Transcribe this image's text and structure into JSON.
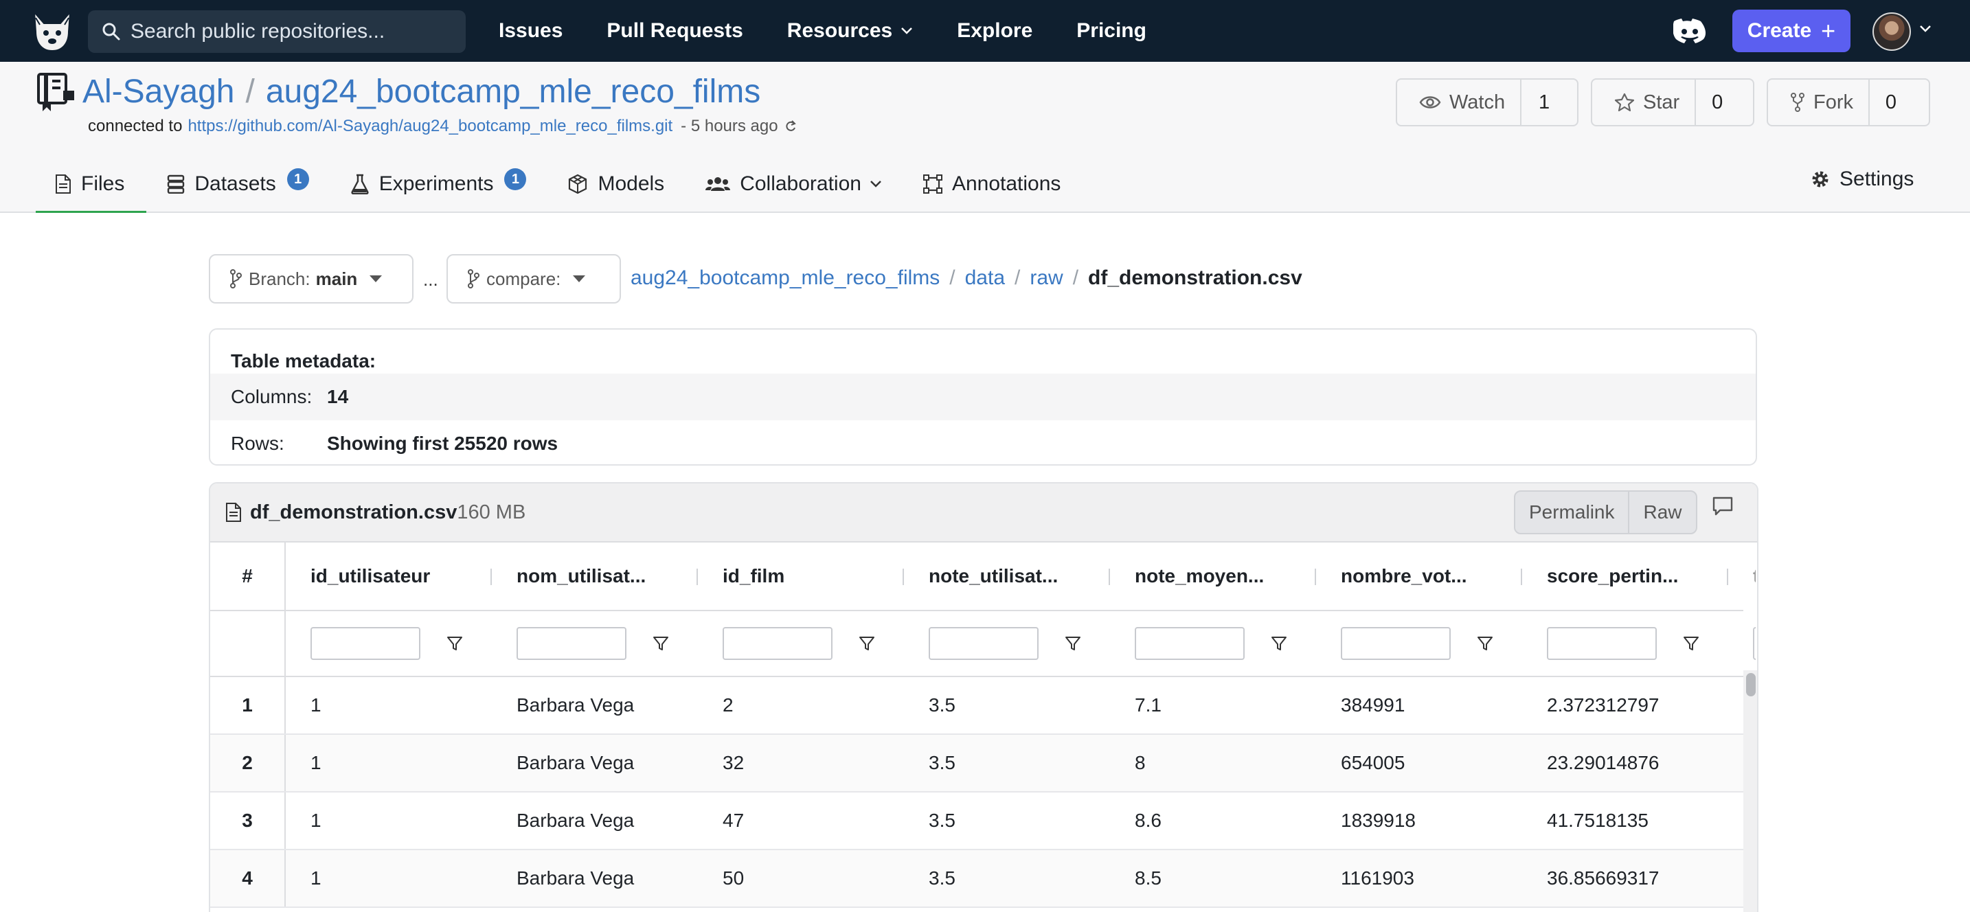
{
  "nav": {
    "search_placeholder": "Search public repositories...",
    "links": [
      "Issues",
      "Pull Requests",
      "Resources",
      "Explore",
      "Pricing"
    ],
    "create_label": "Create",
    "create_icon": "plus-icon"
  },
  "repo": {
    "owner": "Al-Sayagh",
    "separator": "/",
    "name": "aug24_bootcamp_mle_reco_films",
    "connected_label": "connected to",
    "connected_url": "https://github.com/Al-Sayagh/aug24_bootcamp_mle_reco_films.git",
    "updated": "- 5 hours ago",
    "watch_label": "Watch",
    "watch_count": "1",
    "star_label": "Star",
    "star_count": "0",
    "fork_label": "Fork",
    "fork_count": "0"
  },
  "tabs": {
    "files": "Files",
    "datasets": "Datasets",
    "datasets_count": "1",
    "experiments": "Experiments",
    "experiments_count": "1",
    "models": "Models",
    "collaboration": "Collaboration",
    "annotations": "Annotations",
    "settings": "Settings"
  },
  "branch": {
    "label": "Branch:",
    "value": "main",
    "ellipsis": "...",
    "compare_label": "compare:"
  },
  "breadcrumb": {
    "items": [
      "aug24_bootcamp_mle_reco_films",
      "data",
      "raw"
    ],
    "current": "df_demonstration.csv"
  },
  "metadata": {
    "title": "Table metadata:",
    "columns_label": "Columns:",
    "columns_value": "14",
    "rows_label": "Rows:",
    "rows_value": "Showing first 25520 rows"
  },
  "file": {
    "name": "df_demonstration.csv",
    "size": "160 MB",
    "permalink_label": "Permalink",
    "raw_label": "Raw"
  },
  "table": {
    "index_header": "#",
    "columns": [
      "id_utilisateur",
      "nom_utilisat...",
      "id_film",
      "note_utilisat...",
      "note_moyen...",
      "nombre_vot...",
      "score_pertin..."
    ],
    "partial_column": "t",
    "rows": [
      {
        "index": "1",
        "cells": [
          "1",
          "Barbara Vega",
          "2",
          "3.5",
          "7.1",
          "384991",
          "2.372312797"
        ]
      },
      {
        "index": "2",
        "cells": [
          "1",
          "Barbara Vega",
          "32",
          "3.5",
          "8",
          "654005",
          "23.29014876"
        ]
      },
      {
        "index": "3",
        "cells": [
          "1",
          "Barbara Vega",
          "47",
          "3.5",
          "8.6",
          "1839918",
          "41.7518135"
        ]
      },
      {
        "index": "4",
        "cells": [
          "1",
          "Barbara Vega",
          "50",
          "3.5",
          "8.5",
          "1161903",
          "36.85669317"
        ]
      }
    ]
  }
}
